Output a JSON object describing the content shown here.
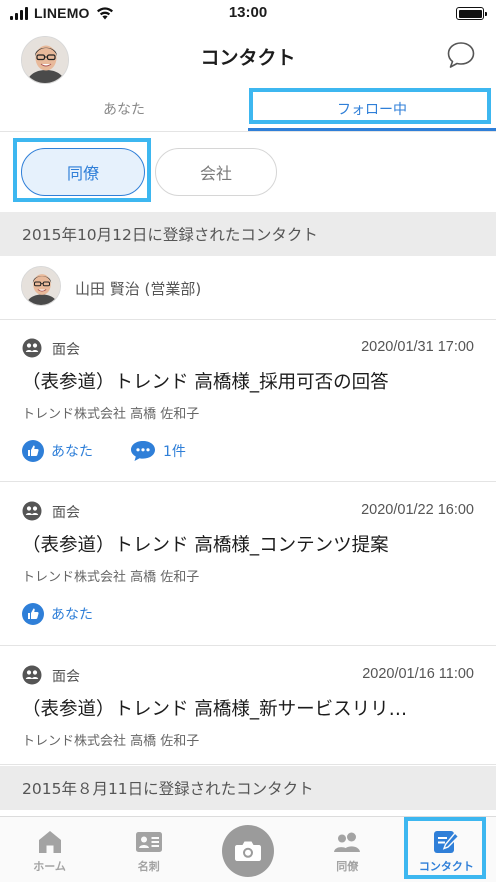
{
  "status_bar": {
    "carrier": "LINEMO",
    "time": "13:00"
  },
  "header": {
    "title": "コンタクト"
  },
  "tabs": [
    {
      "label": "あなた",
      "active": false
    },
    {
      "label": "フォロー中",
      "active": true
    }
  ],
  "filters": [
    {
      "label": "同僚",
      "selected": true
    },
    {
      "label": "会社",
      "selected": false
    }
  ],
  "sections": [
    {
      "date_label": "2015年10月12日に登録されたコンタクト"
    },
    {
      "date_label": "2015年８月11日に登録されたコンタクト"
    }
  ],
  "person": {
    "name": "山田 賢治 (営業部)"
  },
  "contacts": [
    {
      "type": "面会",
      "datetime": "2020/01/31 17:00",
      "title": "（表参道）トレンド 高橋様_採用可否の回答",
      "company": "トレンド株式会社 高橋 佐和子",
      "like_label": "あなた",
      "comment_label": "1件"
    },
    {
      "type": "面会",
      "datetime": "2020/01/22 16:00",
      "title": "（表参道）トレンド 高橋様_コンテンツ提案",
      "company": "トレンド株式会社 高橋 佐和子",
      "like_label": "あなた"
    },
    {
      "type": "面会",
      "datetime": "2020/01/16 11:00",
      "title": "（表参道）トレンド 高橋様_新サービスリリ…",
      "company": "トレンド株式会社 高橋 佐和子"
    }
  ],
  "tabbar": [
    {
      "label": "ホーム",
      "icon": "home-icon"
    },
    {
      "label": "名刺",
      "icon": "business-card-icon"
    },
    {
      "label": "",
      "icon": "camera-icon"
    },
    {
      "label": "同僚",
      "icon": "colleagues-icon"
    },
    {
      "label": "コンタクト",
      "icon": "contact-edit-icon",
      "active": true
    }
  ],
  "colors": {
    "accent": "#2f7fd8",
    "highlight": "#3db7f0",
    "section_bg": "#ebebeb",
    "tab_inactive": "#a3a3a3"
  }
}
